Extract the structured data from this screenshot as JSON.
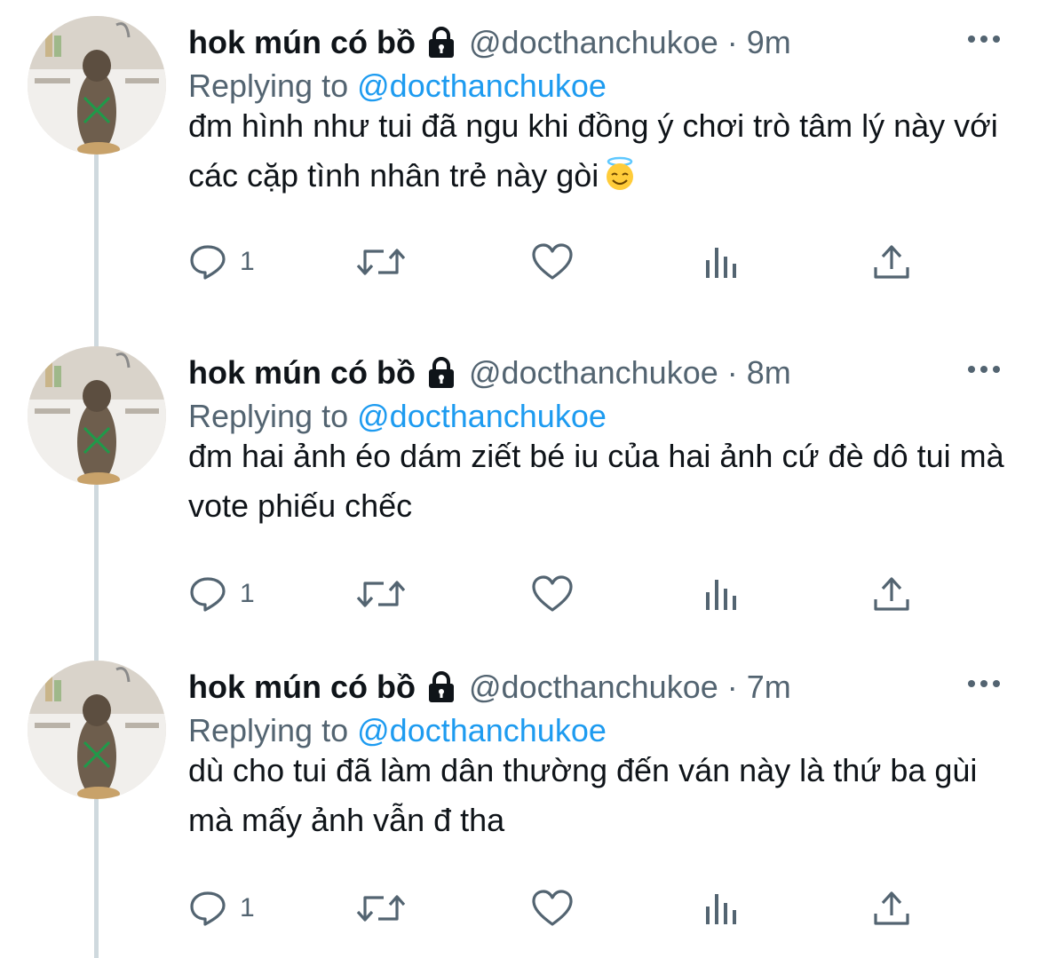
{
  "colors": {
    "text": "#0f1419",
    "secondary": "#536471",
    "link": "#1d9bf0",
    "thread_line": "#cfd9de",
    "background": "#ffffff"
  },
  "tweets": [
    {
      "display_name": "hok mún có bồ",
      "handle": "@docthanchukoe",
      "separator": "·",
      "time": "9m",
      "replying_prefix": "Replying to",
      "replying_to": "@docthanchukoe",
      "text": "đm hình như tui đã ngu khi đồng ý chơi trò tâm lý này với các cặp tình nhân trẻ này gòi",
      "emoji": "smiling-face-with-halo",
      "reply_count": "1",
      "icons": [
        "lock-icon",
        "more-icon",
        "reply-icon",
        "retweet-icon",
        "like-icon",
        "analytics-icon",
        "share-icon"
      ]
    },
    {
      "display_name": "hok mún có bồ",
      "handle": "@docthanchukoe",
      "separator": "·",
      "time": "8m",
      "replying_prefix": "Replying to",
      "replying_to": "@docthanchukoe",
      "text": "đm hai ảnh éo dám ziết bé iu của hai ảnh cứ đè dô tui mà vote phiếu chếc",
      "reply_count": "1",
      "icons": [
        "lock-icon",
        "more-icon",
        "reply-icon",
        "retweet-icon",
        "like-icon",
        "analytics-icon",
        "share-icon"
      ]
    },
    {
      "display_name": "hok mún có bồ",
      "handle": "@docthanchukoe",
      "separator": "·",
      "time": "7m",
      "replying_prefix": "Replying to",
      "replying_to": "@docthanchukoe",
      "text": "dù cho tui đã làm dân thường đến ván này là thứ ba gùi mà mấy ảnh vẫn đ tha",
      "reply_count": "1",
      "icons": [
        "lock-icon",
        "more-icon",
        "reply-icon",
        "retweet-icon",
        "like-icon",
        "analytics-icon",
        "share-icon"
      ]
    }
  ]
}
